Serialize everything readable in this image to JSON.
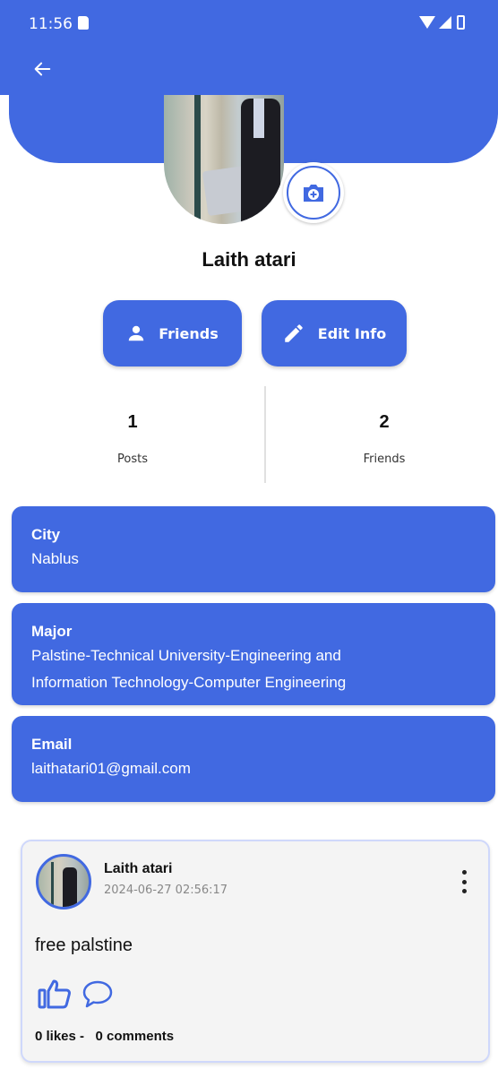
{
  "status_bar": {
    "time": "11:56"
  },
  "profile": {
    "name": "Laith atari"
  },
  "actions": {
    "friends_label": "Friends",
    "edit_label": "Edit Info"
  },
  "stats": {
    "posts": {
      "value": "1",
      "label": "Posts"
    },
    "friends": {
      "value": "2",
      "label": "Friends"
    }
  },
  "info": {
    "city": {
      "title": "City",
      "value": "Nablus"
    },
    "major": {
      "title": "Major",
      "value_line1": "Palstine-Technical University-Engineering and",
      "value_line2": "Information Technology-Computer Engineering"
    },
    "email": {
      "title": "Email",
      "value": "laithatari01@gmail.com"
    }
  },
  "post": {
    "author": "Laith atari",
    "timestamp": "2024-06-27 02:56:17",
    "text": "free palstine",
    "stats": "0 likes -   0 comments"
  },
  "colors": {
    "primary": "#4169e1",
    "post_background": "#f4f4f4"
  },
  "icons": [
    "back-arrow-icon",
    "sd-card-icon",
    "wifi-icon",
    "signal-icon",
    "battery-icon",
    "camera-plus-icon",
    "person-icon",
    "pencil-icon",
    "more-vert-icon",
    "thumb-up-icon",
    "comment-icon"
  ]
}
